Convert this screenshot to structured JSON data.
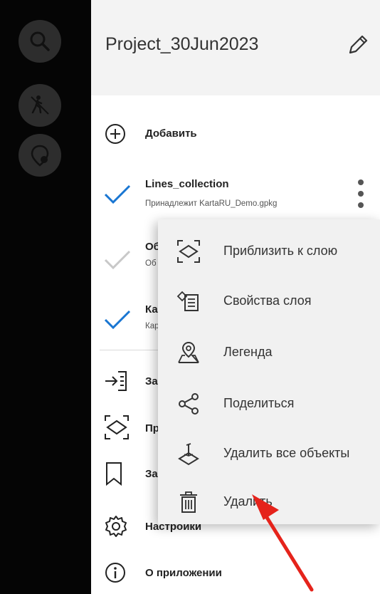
{
  "drawer": {
    "project_title": "Project_30Jun2023",
    "add_label": "Добавить",
    "layers": [
      {
        "title": "Lines_collection",
        "subtitle": "Принадлежит KartaRU_Demo.gpkg",
        "checked": true
      },
      {
        "title": "Об",
        "subtitle": "Об",
        "checked": false
      },
      {
        "title": "Ка",
        "subtitle": "Кар",
        "checked": true
      }
    ],
    "menu_items": [
      {
        "label": "За",
        "icon": "import-icon"
      },
      {
        "label": "Пр",
        "icon": "zoom-layer-icon"
      },
      {
        "label": "За",
        "icon": "bookmark-icon"
      },
      {
        "label": "Настройки",
        "icon": "gear-icon"
      },
      {
        "label": "О приложении",
        "icon": "info-icon"
      }
    ]
  },
  "context_menu": {
    "items": [
      {
        "label": "Приблизить к слою",
        "icon": "zoom-to-layer-icon"
      },
      {
        "label": "Свойства слоя",
        "icon": "layer-properties-icon"
      },
      {
        "label": "Легенда",
        "icon": "legend-map-icon"
      },
      {
        "label": "Поделиться",
        "icon": "share-icon"
      },
      {
        "label": "Удалить все объекты",
        "icon": "delete-features-icon"
      },
      {
        "label": "Удалить",
        "icon": "trash-icon"
      }
    ]
  },
  "colors": {
    "accent_check": "#1976d2",
    "disabled_check": "#c8c8c8",
    "annotation_arrow": "#e5231b",
    "map_background": "#050505",
    "menu_background": "#f1f1f1"
  }
}
